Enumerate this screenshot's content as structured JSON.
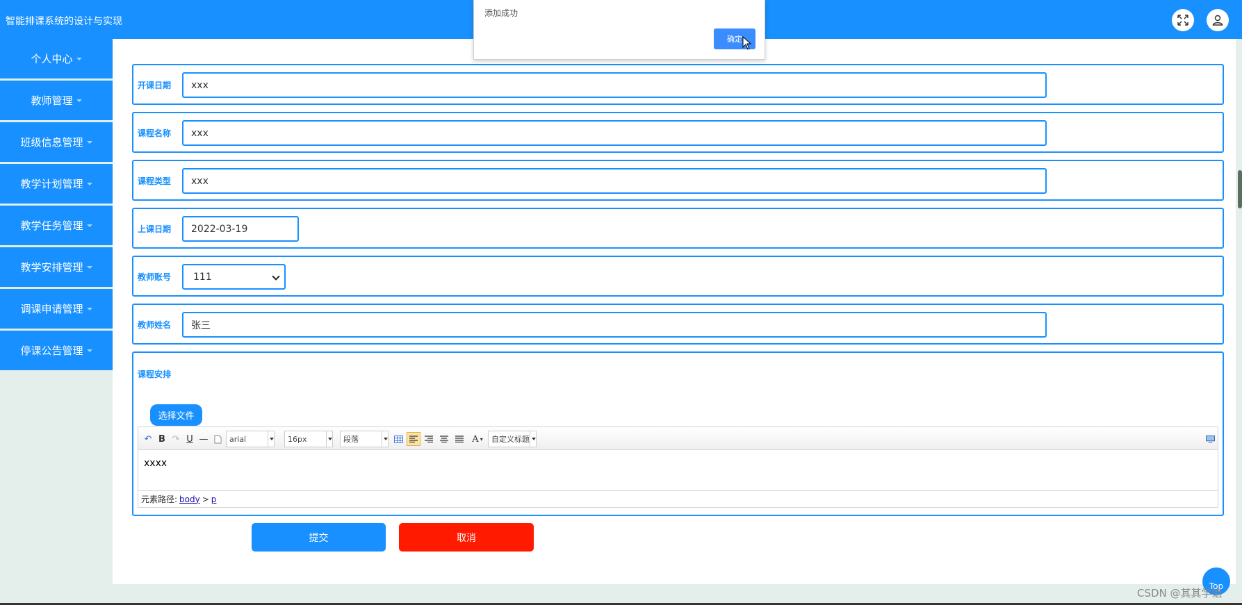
{
  "header": {
    "title": "智能排课系统的设计与实现",
    "fullscreen_icon": "fullscreen-icon",
    "user_icon": "user-icon",
    "color": "#1890ff"
  },
  "sidebar": {
    "items": [
      {
        "label": "个人中心"
      },
      {
        "label": "教师管理"
      },
      {
        "label": "班级信息管理"
      },
      {
        "label": "教学计划管理"
      },
      {
        "label": "教学任务管理"
      },
      {
        "label": "教学安排管理"
      },
      {
        "label": "调课申请管理"
      },
      {
        "label": "停课公告管理"
      }
    ]
  },
  "dialog": {
    "message": "添加成功",
    "ok_label": "确定"
  },
  "form": {
    "start_date": {
      "label": "开课日期",
      "value": "xxx"
    },
    "course_name": {
      "label": "课程名称",
      "value": "xxx"
    },
    "course_type": {
      "label": "课程类型",
      "value": "xxx"
    },
    "class_date": {
      "label": "上课日期",
      "value": "2022-03-19"
    },
    "teacher_account": {
      "label": "教师账号",
      "value": "111"
    },
    "teacher_name": {
      "label": "教师姓名",
      "value": "张三"
    },
    "schedule": {
      "label": "课程安排",
      "file_button": "选择文件",
      "font_family": "arial",
      "font_size": "16px",
      "paragraph": "段落",
      "custom_heading": "自定义标题",
      "content": "xxxx",
      "path_label": "元素路径:",
      "path_body": "body",
      "path_sep": ">",
      "path_p": "p"
    },
    "submit_label": "提交",
    "cancel_label": "取消",
    "cancel_color": "#ff1a00"
  },
  "back_to_top": "Top",
  "watermark": "CSDN @其其学姐"
}
